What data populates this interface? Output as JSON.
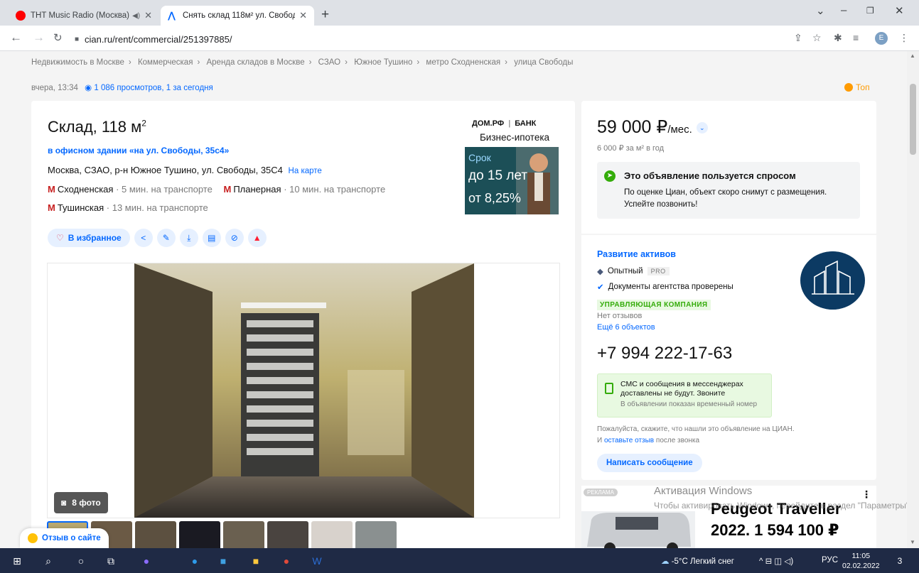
{
  "browser": {
    "tabs": [
      {
        "title": "ТНТ Music Radio (Москва) –",
        "active": false,
        "favicon_color": "#ff0000"
      },
      {
        "title": "Снять склад 118м² ул. Свободы,",
        "active": true,
        "favicon_color": "#0468ff"
      }
    ],
    "url": "cian.ru/rent/commercial/251397885/",
    "profile_initial": "E"
  },
  "breadcrumbs": [
    "Недвижимость в Москве",
    "Коммерческая",
    "Аренда складов в Москве",
    "СЗАО",
    "Южное Тушино",
    "метро Сходненская",
    "улица Свободы"
  ],
  "meta": {
    "date": "вчера, 13:34",
    "views": "1 086 просмотров, 1 за сегодня",
    "top_label": "Топ"
  },
  "listing": {
    "title": "Склад, 118 м",
    "title_sup": "2",
    "building": "в офисном здании «на ул. Свободы, 35с4»",
    "address": "Москва, СЗАО, р-н Южное Тушино, ул. Свободы, 35С4",
    "on_map": "На карте",
    "metro": [
      {
        "name": "Сходненская",
        "distance": "· 5 мин. на транспорте"
      },
      {
        "name": "Планерная",
        "distance": "· 10 мин. на транспорте"
      },
      {
        "name": "Тушинская",
        "distance": "· 13 мин. на транспорте"
      }
    ],
    "favorite_label": "В избранное",
    "photo_count": "8 фото"
  },
  "ad_mortgage": {
    "brand": "ДОМ.РФ",
    "bank": "БАНК",
    "title": "Бизнес-ипотека",
    "term_label": "Срок",
    "term_value": "до 15 лет",
    "rate": "от 8,25%"
  },
  "price": {
    "value": "59 000 ₽",
    "period": "/мес.",
    "per_m2": "6 000 ₽ за м² в год",
    "demand_title": "Это объявление пользуется спросом",
    "demand_text": "По оценке Циан, объект скоро снимут с размещения. Успейте позвонить!"
  },
  "agent": {
    "name": "Развитие активов",
    "level": "Опытный",
    "pro": "PRO",
    "verified": "Документы агентства проверены",
    "company_type": "УПРАВЛЯЮЩАЯ КОМПАНИЯ",
    "reviews": "Нет отзывов",
    "more_objects": "Ещё 6 объектов",
    "phone": "+7 994 222-17-63",
    "sms_text": "СМС и сообщения в мессенджерах доставлены не будут. Звоните",
    "sms_note": "В объявлении показан временный номер",
    "please_text_1": "Пожалуйста, скажите, что нашли это объявление на ЦИАН. И",
    "please_link": "оставьте отзыв",
    "please_text_2": "после звонка",
    "write_button": "Написать сообщение"
  },
  "ad_car": {
    "label": "РЕКЛАМА",
    "title": "Peugeot Traveller 2022. 1 594 100 ₽"
  },
  "activation": {
    "title": "Активация Windows",
    "text": "Чтобы активировать Windows, перейдите в раздел \"Параметры\"."
  },
  "feedback_label": "Отзыв о сайте",
  "taskbar": {
    "weather": "-5°C Легкий снег",
    "lang": "РУС",
    "time": "11:05",
    "date": "02.02.2022",
    "notifications": "3"
  }
}
